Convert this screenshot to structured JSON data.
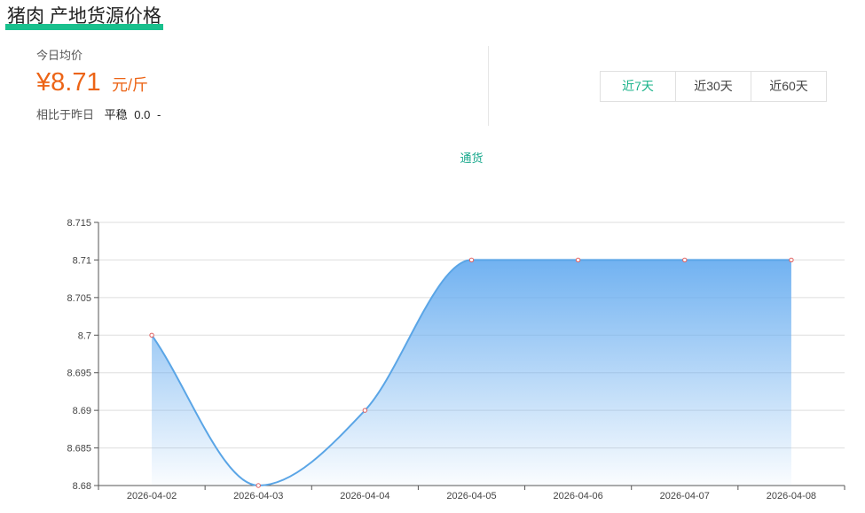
{
  "header": {
    "title": "猪肉 产地货源价格"
  },
  "stats": {
    "today_label": "今日均价",
    "price": "¥8.71",
    "unit": "元/斤",
    "compare_label": "相比于昨日",
    "trend": "平稳",
    "delta": "0.0",
    "sign": "-"
  },
  "range_tabs": [
    {
      "label": "近7天",
      "active": true
    },
    {
      "label": "近30天",
      "active": false
    },
    {
      "label": "近60天",
      "active": false
    }
  ],
  "colors": {
    "accent": "#19b38a",
    "price": "#ec6416",
    "line": "#5aa5e6",
    "area_top": "#6aaef0",
    "point": "#e06060"
  },
  "chart_data": {
    "type": "area",
    "x": [
      "2026-04-02",
      "2026-04-03",
      "2026-04-04",
      "2026-04-05",
      "2026-04-06",
      "2026-04-07",
      "2026-04-08"
    ],
    "series": [
      {
        "name": "通货",
        "values": [
          8.7,
          8.68,
          8.69,
          8.71,
          8.71,
          8.71,
          8.71
        ]
      }
    ],
    "title": "",
    "xlabel": "",
    "ylabel": "",
    "ylim": [
      8.68,
      8.715
    ],
    "yticks": [
      "8.68",
      "8.685",
      "8.69",
      "8.695",
      "8.7",
      "8.705",
      "8.71",
      "8.715"
    ],
    "grid": true,
    "legend": "top-center"
  }
}
